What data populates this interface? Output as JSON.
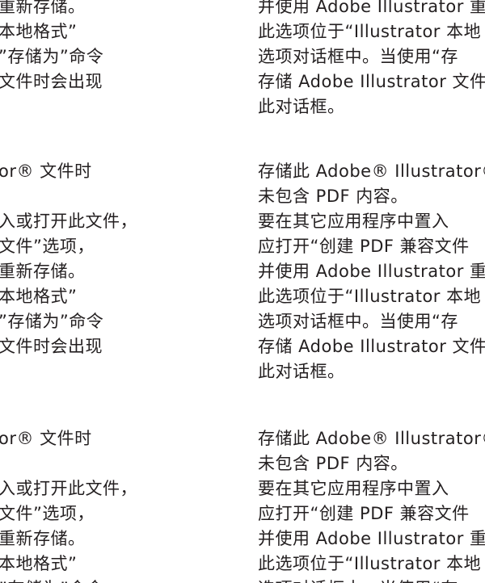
{
  "left_column": {
    "blocks": [
      {
        "lines": [
          "重新存储。",
          "本地格式”",
          "”存储为”命令",
          "文件时会出现"
        ]
      },
      {
        "lines": [
          "or® 文件时",
          "",
          "入或打开此文件，",
          "文件”选项，",
          "重新存储。",
          "本地格式”",
          "”存储为”命令",
          "文件时会出现"
        ]
      },
      {
        "lines": [
          "or® 文件时",
          "",
          "入或打开此文件，",
          "文件”选项，",
          "重新存储。",
          "本地格式”",
          "”存储为”命令"
        ]
      }
    ]
  },
  "right_column": {
    "blocks": [
      {
        "lines": [
          "并使用 Adobe Illustrator 重",
          "此选项位于“Illustrator 本地",
          "选项对话框中。当使用“存",
          "存储 Adobe Illustrator 文件",
          "此对话框。"
        ]
      },
      {
        "lines": [
          "存储此 Adobe® Illustrator®",
          "未包含 PDF 内容。",
          "要在其它应用程序中置入",
          "应打开“创建 PDF 兼容文件",
          "并使用 Adobe Illustrator 重",
          "此选项位于“Illustrator 本地",
          "选项对话框中。当使用“存",
          "存储 Adobe Illustrator 文件",
          "此对话框。"
        ]
      },
      {
        "lines": [
          "存储此 Adobe® Illustrator®",
          "未包含 PDF 内容。",
          "要在其它应用程序中置入",
          "应打开“创建 PDF 兼容文件",
          "并使用 Adobe Illustrator 重",
          "此选项位于“Illustrator 本地",
          "选项对话框中。当使用“存"
        ]
      }
    ]
  }
}
